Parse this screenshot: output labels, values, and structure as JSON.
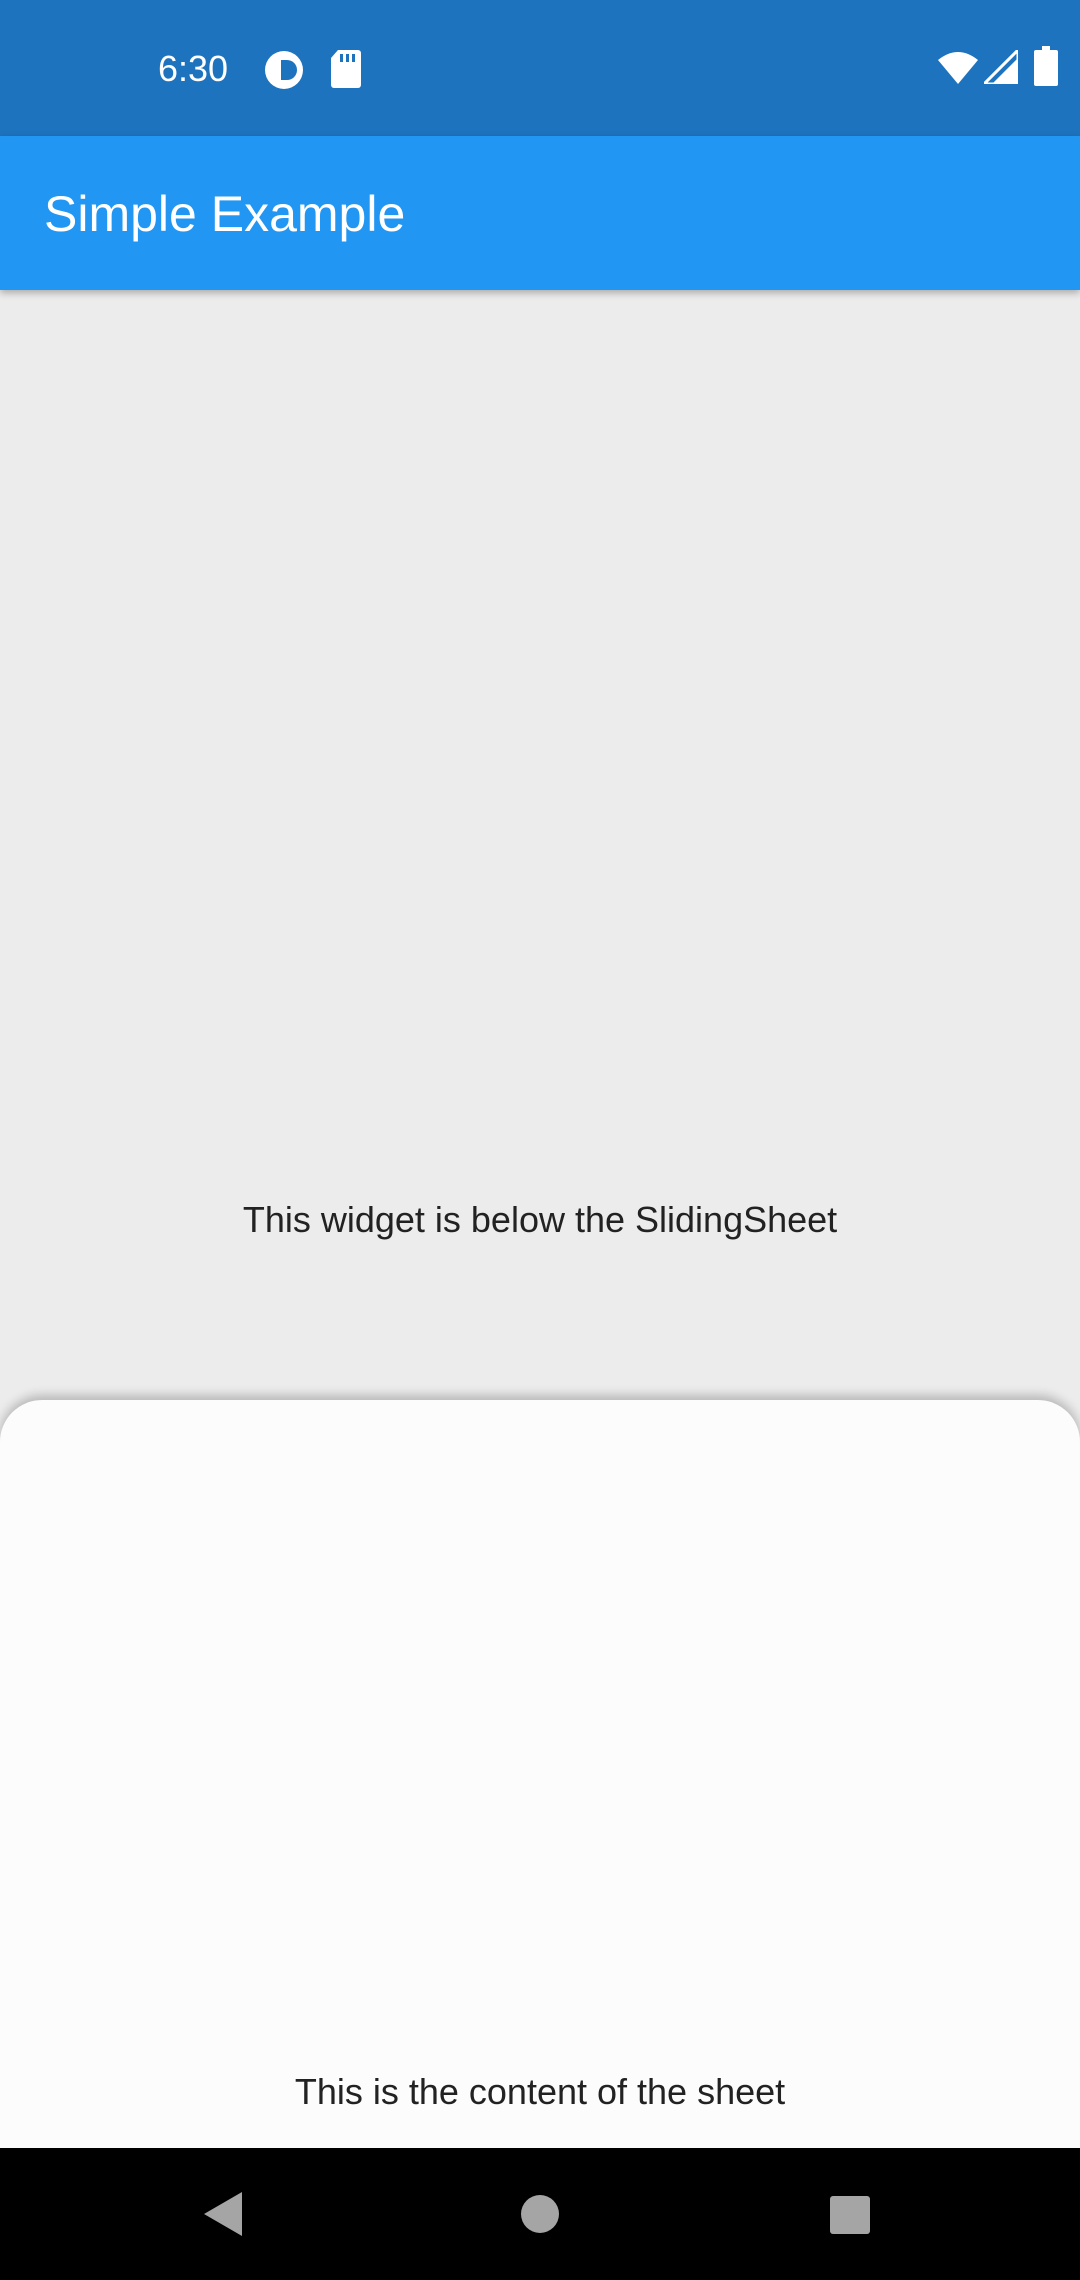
{
  "status_bar": {
    "time": "6:30",
    "background": "#1e73be",
    "icons": [
      "profile-icon",
      "sd-card-icon",
      "wifi-icon",
      "signal-icon",
      "battery-icon"
    ]
  },
  "app_bar": {
    "title": "Simple Example",
    "color": "#2196f3"
  },
  "background_widget": {
    "text": "This widget is below the SlidingSheet"
  },
  "sheet": {
    "content_text": "This is the content of the sheet"
  },
  "nav_bar": {
    "buttons": [
      "back-icon",
      "home-icon",
      "recents-icon"
    ]
  }
}
